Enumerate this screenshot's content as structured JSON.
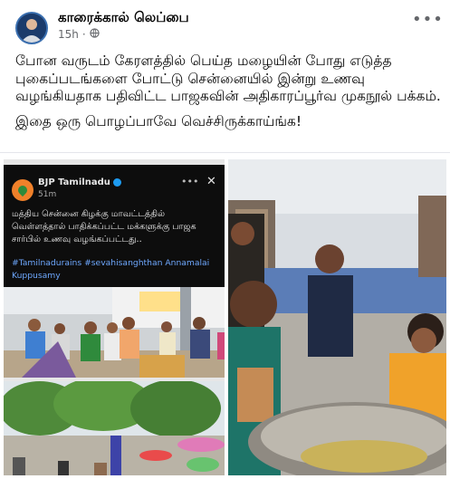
{
  "post": {
    "page_name": "காரைக்கால் லெப்பை",
    "time": "15h",
    "privacy_icon": "globe-icon",
    "more_label": "•••",
    "paragraphs": [
      "போன வருடம் கேரளத்தில் பெய்த மழையின் போது எடுத்த புகைப்படங்களை போட்டு சென்னையில் இன்று உணவு வழங்கியதாக பதிவிட்ட பாஜகவின் அதிகாரப்பூர்வ முகநூல் பக்கம்.",
      "இதை ஒரு பொழப்பாவே வெச்சிருக்காய்ங்க!"
    ]
  },
  "embedded_tweet": {
    "account": "BJP Tamilnadu",
    "time": "51m",
    "dots": "•••",
    "close": "✕",
    "body": "மத்திய சென்னை கிழக்கு மாவட்டத்தில் வெள்ளத்தால் பாதிக்கப்பட்ட மக்களுக்கு பாஜக சார்பில் உணவு வழங்கப்பட்டது..",
    "hashtags": "#Tamilnadurains #sevahisanghthan Annamalai Kuppusamy"
  },
  "colors": {
    "text_primary": "#050505",
    "text_secondary": "#65676b",
    "tweet_bg": "#0d0d0d",
    "hashtag": "#6ea8fe",
    "verified": "#1d9bf0"
  }
}
